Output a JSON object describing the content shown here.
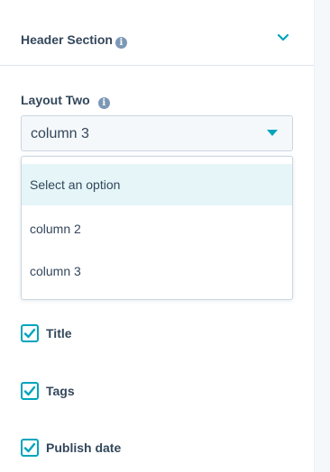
{
  "header_section": {
    "title": "Header Section",
    "info_glyph": "i",
    "expanded_icon": "chevron-down-icon"
  },
  "layout_field": {
    "label": "Layout Two",
    "info_glyph": "i",
    "selected_value": "column 3",
    "options": [
      {
        "label": "Select an option",
        "highlighted": true
      },
      {
        "label": "column 2",
        "highlighted": false
      },
      {
        "label": "column 3",
        "highlighted": false
      }
    ]
  },
  "checkboxes": [
    {
      "label": "Title",
      "checked": true
    },
    {
      "label": "Tags",
      "checked": true
    },
    {
      "label": "Publish date",
      "checked": true
    }
  ],
  "colors": {
    "accent": "#00a4bd",
    "text": "#33475b",
    "highlight": "#e5f5f8",
    "info_icon": "#7c98b6"
  }
}
